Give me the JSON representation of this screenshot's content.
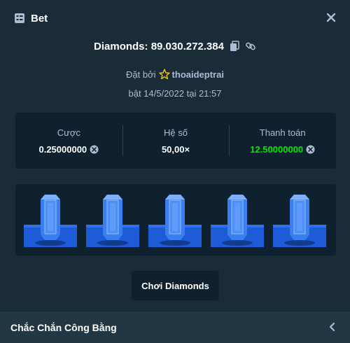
{
  "header": {
    "title": "Bet",
    "icon": "bet-slip-icon",
    "close_icon": "close-icon"
  },
  "bet_id": {
    "label": "Diamonds: 89.030.272.384",
    "copy_icon": "copy-icon",
    "link_icon": "link-icon"
  },
  "placed_by": {
    "prefix": "Đặt bởi",
    "icon": "star-icon",
    "username": "thoaideptrai"
  },
  "date": "bật 14/5/2022 tại 21:57",
  "stats": {
    "wager": {
      "label": "Cược",
      "value": "0.25000000",
      "currency_icon": "currency-icon"
    },
    "multiplier": {
      "label": "Hệ số",
      "value": "50,00×"
    },
    "payout": {
      "label": "Thanh toán",
      "value": "12.50000000",
      "currency_icon": "currency-icon",
      "color": "#00e701"
    }
  },
  "gems": [
    "blue-gem",
    "blue-gem",
    "blue-gem",
    "blue-gem",
    "blue-gem"
  ],
  "play_button": "Chơi Diamonds",
  "footer": {
    "label": "Chắc Chắn Công Bằng",
    "icon": "chevron-left-icon"
  },
  "colors": {
    "background": "#1a2c38",
    "panel": "#0f212e",
    "footer": "#213743",
    "muted": "#b1bad3",
    "green": "#00e701",
    "gem": "#3a7ef0"
  }
}
